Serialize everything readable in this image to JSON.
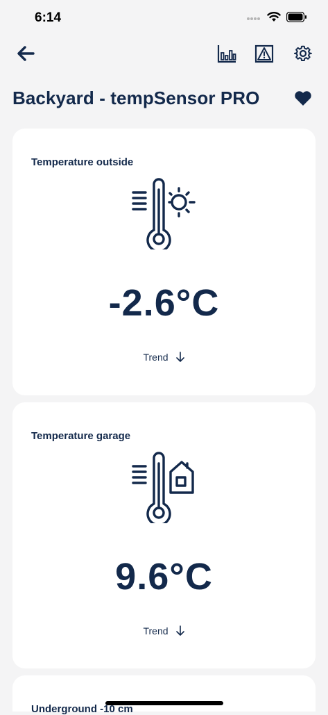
{
  "status": {
    "time": "6:14"
  },
  "device": {
    "title": "Backyard - tempSensor PRO"
  },
  "cards": [
    {
      "label": "Temperature outside",
      "value": "-2.6°C",
      "trend_label": "Trend",
      "trend_direction": "down"
    },
    {
      "label": "Temperature garage",
      "value": "9.6°C",
      "trend_label": "Trend",
      "trend_direction": "down"
    },
    {
      "label": "Underground -10 cm"
    }
  ],
  "colors": {
    "primary": "#13294b",
    "background": "#f4f4f5",
    "card": "#ffffff"
  }
}
